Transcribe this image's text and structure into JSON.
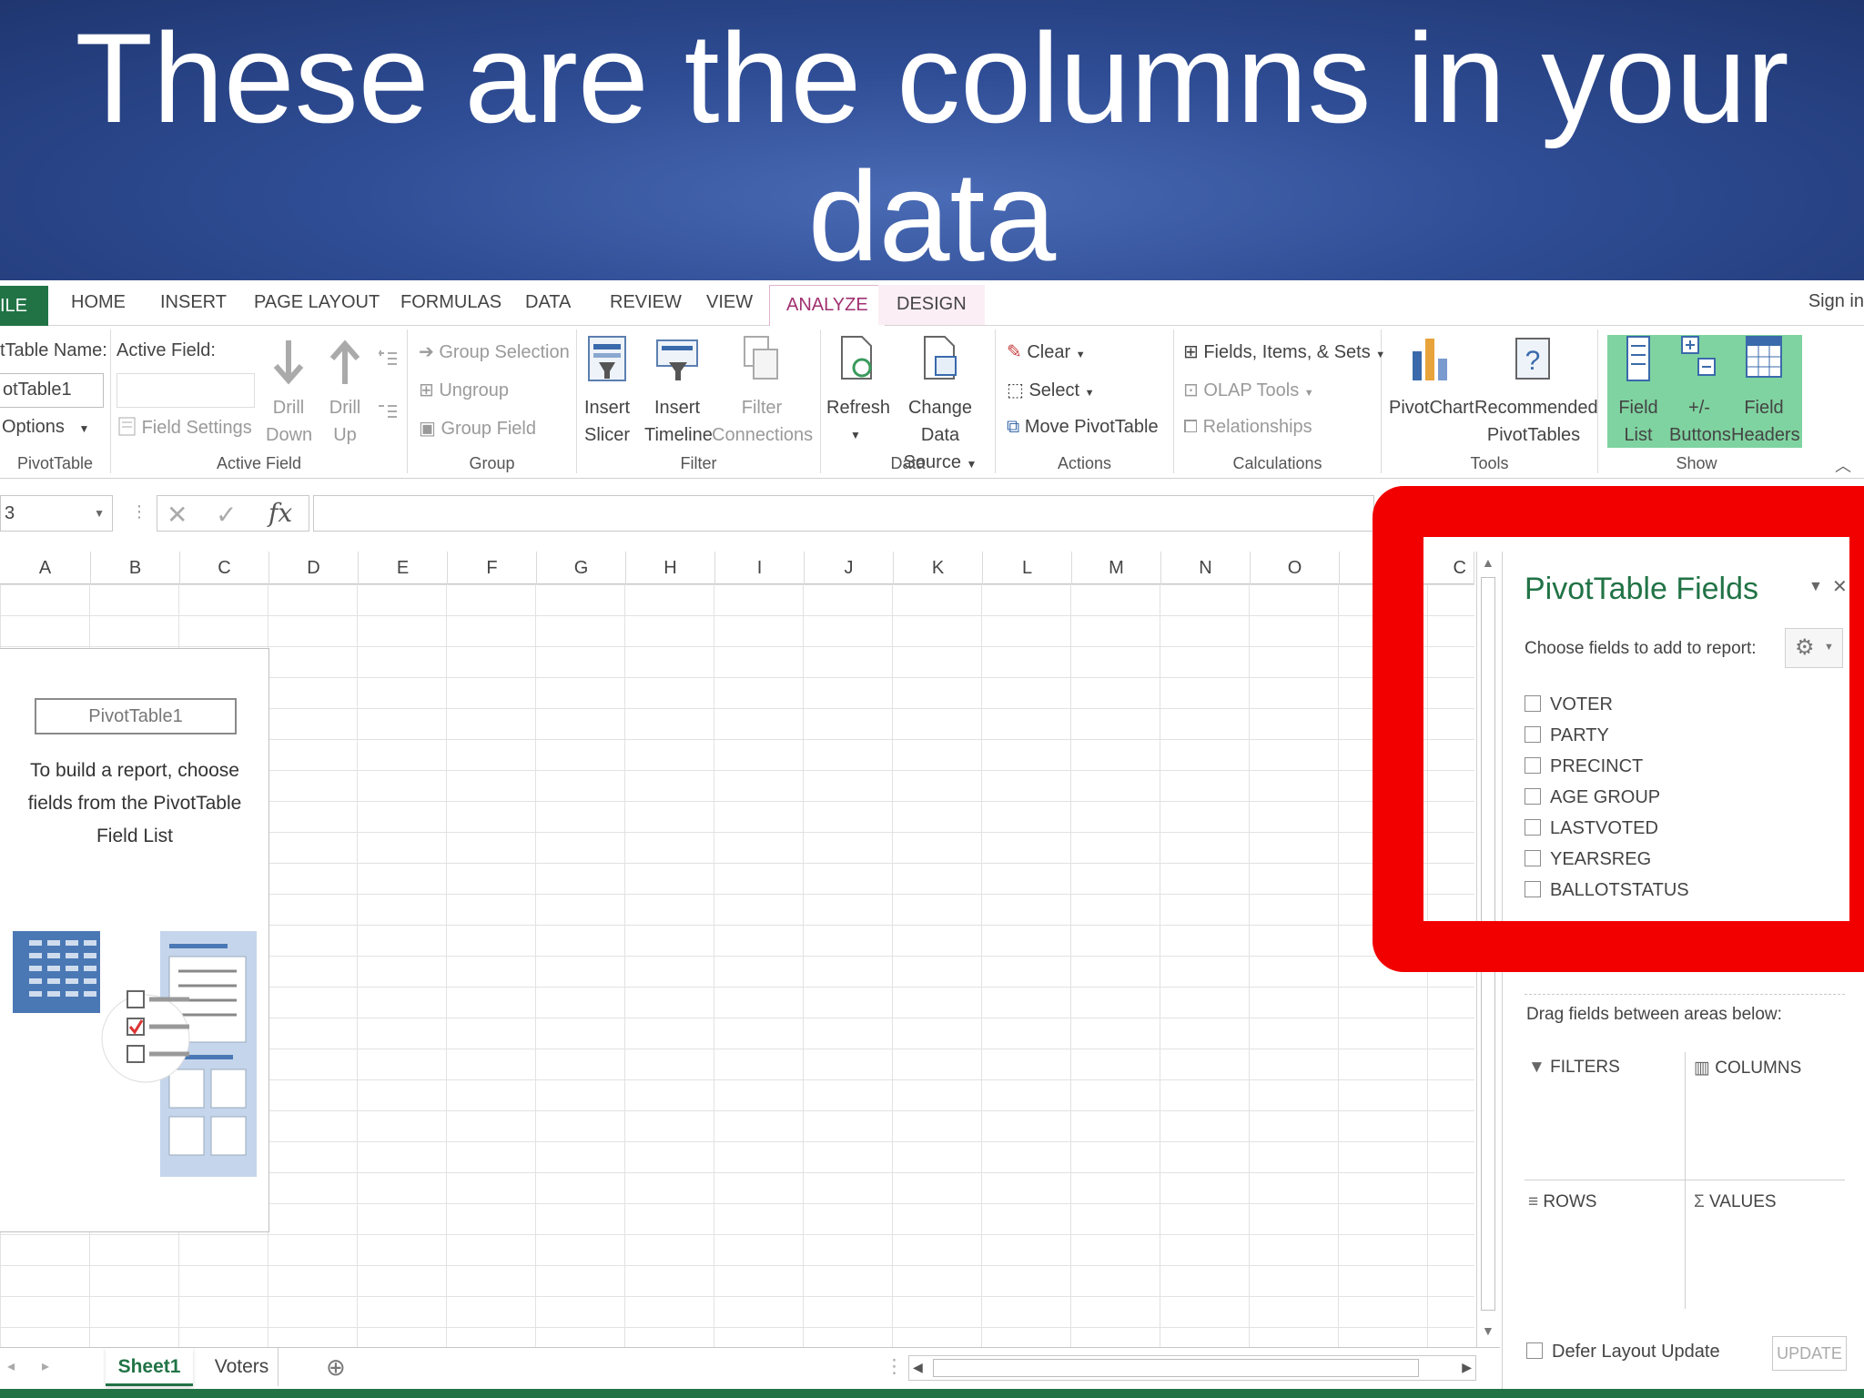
{
  "slide_title": {
    "line1": "These are the columns in your",
    "line2": "data"
  },
  "tabs": {
    "file": "ILE",
    "home": "HOME",
    "insert": "INSERT",
    "page_layout": "PAGE LAYOUT",
    "formulas": "FORMULAS",
    "data": "DATA",
    "review": "REVIEW",
    "view": "VIEW",
    "analyze": "ANALYZE",
    "design": "DESIGN",
    "sign_in": "Sign in"
  },
  "ribbon": {
    "pivottable": {
      "name_label": "tTable Name:",
      "name_value": "otTable1",
      "options": "Options",
      "group": "PivotTable"
    },
    "active_field": {
      "label": "Active Field:",
      "field_settings": "Field Settings",
      "drill_down": [
        "Drill",
        "Down"
      ],
      "drill_up": [
        "Drill",
        "Up"
      ],
      "group": "Active Field"
    },
    "group": {
      "group_selection": "Group Selection",
      "ungroup": "Ungroup",
      "group_field": "Group Field",
      "group": "Group"
    },
    "filter": {
      "insert_slicer": [
        "Insert",
        "Slicer"
      ],
      "insert_timeline": [
        "Insert",
        "Timeline"
      ],
      "filter_connections": [
        "Filter",
        "Connections"
      ],
      "group": "Filter"
    },
    "data": {
      "refresh": "Refresh",
      "change_data_source": [
        "Change Data",
        "Source"
      ],
      "group": "Data"
    },
    "actions": {
      "clear": "Clear",
      "select": "Select",
      "move_pivottable": "Move PivotTable",
      "group": "Actions"
    },
    "calculations": {
      "fields_items_sets": "Fields, Items, & Sets",
      "olap_tools": "OLAP Tools",
      "relationships": "Relationships",
      "group": "Calculations"
    },
    "tools": {
      "pivotchart": "PivotChart",
      "recommended": [
        "Recommended",
        "PivotTables"
      ],
      "group": "Tools"
    },
    "show": {
      "field_list": [
        "Field",
        "List"
      ],
      "buttons": [
        "+/-",
        "Buttons"
      ],
      "field_headers": [
        "Field",
        "Headers"
      ],
      "group": "Show"
    }
  },
  "formula_bar": {
    "name_box": "3",
    "fx": "fx"
  },
  "columns": [
    "A",
    "B",
    "C",
    "D",
    "E",
    "F",
    "G",
    "H",
    "I",
    "J",
    "K",
    "L",
    "M",
    "N",
    "O",
    "C"
  ],
  "placeholder": {
    "name": "PivotTable1",
    "message": "To build a report, choose fields from the PivotTable Field List"
  },
  "sheets": {
    "sheet1": "Sheet1",
    "voters": "Voters"
  },
  "pane": {
    "title": "PivotTable Fields",
    "subtitle": "Choose fields to add to report:",
    "fields": [
      "VOTER",
      "PARTY",
      "PRECINCT",
      "AGE GROUP",
      "LASTVOTED",
      "YEARSREG",
      "BALLOTSTATUS"
    ],
    "drag_text": "Drag fields between areas below:",
    "areas": {
      "filters": "FILTERS",
      "columns": "COLUMNS",
      "rows": "ROWS",
      "values": "VALUES"
    },
    "defer": "Defer Layout Update",
    "update": "UPDATE"
  },
  "colors": {
    "excel_green": "#217346",
    "highlight_red": "#f20000",
    "analyze_accent": "#a03170",
    "banner_blue": "#2f4d95"
  }
}
